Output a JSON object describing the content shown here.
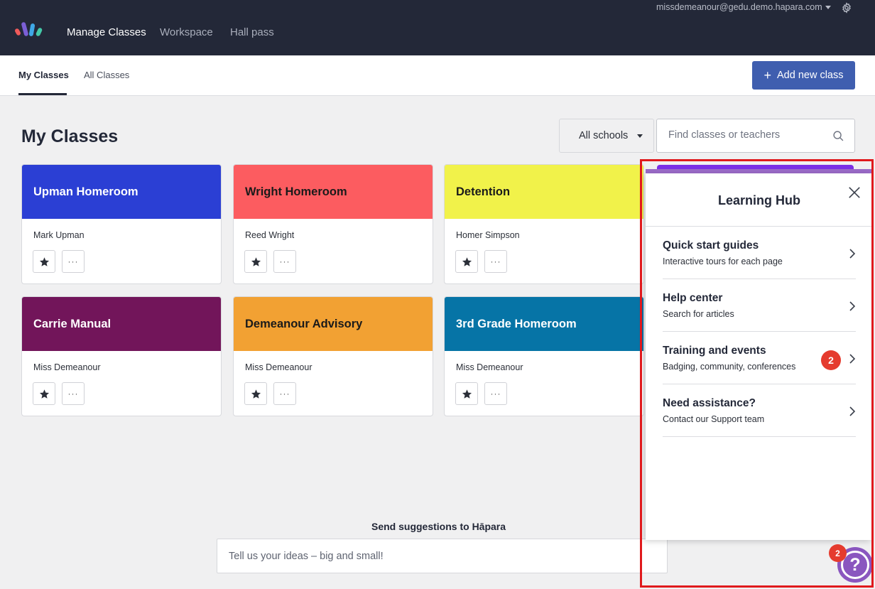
{
  "topnav": {
    "items": [
      "Manage Classes",
      "Workspace",
      "Hall pass"
    ],
    "user_email": "missdemeanour@gedu.demo.hapara.com",
    "logo_colors": [
      "#ef5a5a",
      "#7b5fd6",
      "#3fa8e6",
      "#43c9a8"
    ]
  },
  "subnav": {
    "tabs": [
      "My Classes",
      "All Classes"
    ],
    "active_tab": "My Classes",
    "add_button_label": "Add new class"
  },
  "main": {
    "title": "My Classes",
    "school_filter": "All schools",
    "search_placeholder": "Find classes or teachers"
  },
  "classes": [
    {
      "name": "Upman Homeroom",
      "teacher": "Mark Upman",
      "color": "#2b3fd4",
      "text_color": "#ffffff"
    },
    {
      "name": "Wright Homeroom",
      "teacher": "Reed Wright",
      "color": "#fc5c60",
      "text_color": "#1a1a1a"
    },
    {
      "name": "Detention",
      "teacher": "Homer Simpson",
      "color": "#f1f24a",
      "text_color": "#1a1a1a"
    },
    {
      "name": "Carrie Manual",
      "teacher": "Miss Demeanour",
      "color": "#72155a",
      "text_color": "#ffffff"
    },
    {
      "name": "Demeanour Advisory",
      "teacher": "Miss Demeanour",
      "color": "#f2a133",
      "text_color": "#1a1a1a"
    },
    {
      "name": "3rd Grade Homeroom",
      "teacher": "Miss Demeanour",
      "color": "#0674a6",
      "text_color": "#ffffff"
    }
  ],
  "suggestions": {
    "label": "Send suggestions to Hāpara",
    "placeholder": "Tell us your ideas – big and small!"
  },
  "learning_hub": {
    "title": "Learning Hub",
    "items": [
      {
        "title": "Quick start guides",
        "subtitle": "Interactive tours for each page"
      },
      {
        "title": "Help center",
        "subtitle": "Search for articles"
      },
      {
        "title": "Training and events",
        "subtitle": "Badging, community, conferences",
        "badge": "2"
      },
      {
        "title": "Need assistance?",
        "subtitle": "Contact our Support team"
      }
    ],
    "help_badge": "2"
  }
}
